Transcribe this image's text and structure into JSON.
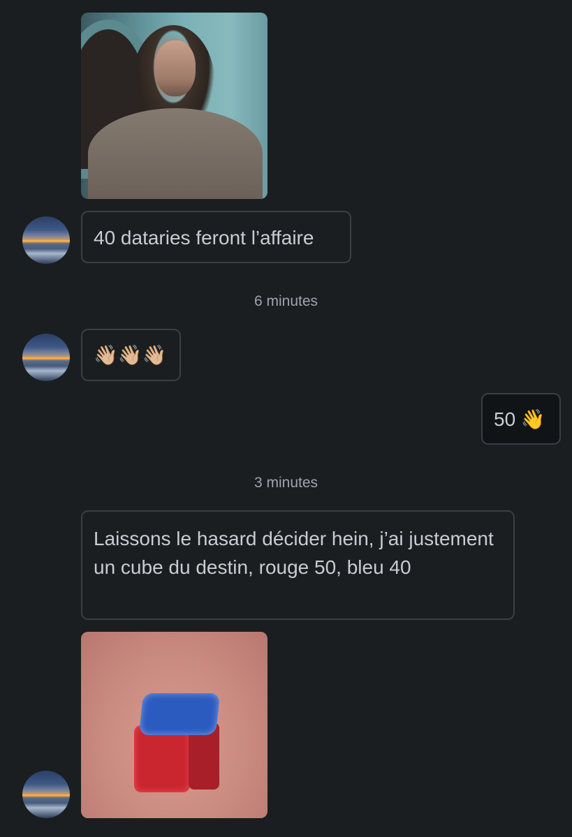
{
  "messages": {
    "msg1": {
      "text": "40 dataries feront l’affaire"
    },
    "msg2": {
      "text": "👋🏼👋🏼👋🏼"
    },
    "msg3": {
      "text": "50 👋"
    },
    "msg4": {
      "text": "Laissons le hasard décider hein, j’ai justement un cube du destin, rouge 50, bleu 40"
    }
  },
  "timestamps": {
    "t1": "6 minutes",
    "t2": "3 minutes"
  },
  "colors": {
    "background": "#1a1e20",
    "bubble_border": "#3a3f43",
    "text": "#c9cdd1",
    "timestamp": "#a0a5aa"
  }
}
